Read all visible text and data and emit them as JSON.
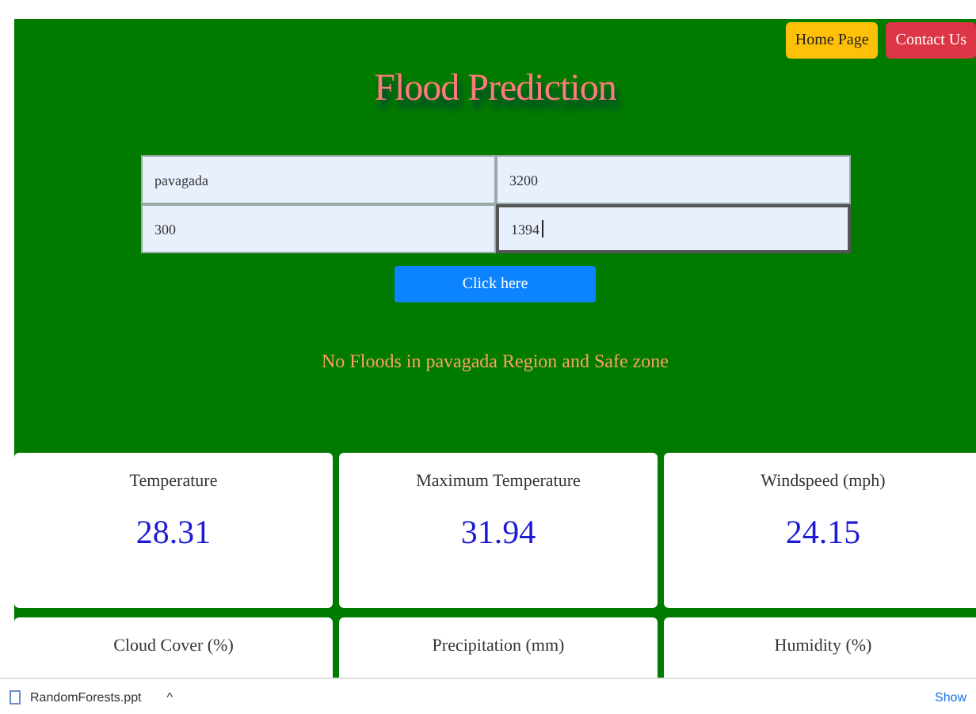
{
  "nav": {
    "buttons": [
      {
        "label": "Home Page",
        "kind": "warning"
      },
      {
        "label": "Contact Us",
        "kind": "danger"
      }
    ]
  },
  "title": "Flood Prediction",
  "form": {
    "fields": [
      {
        "value": "pavagada",
        "focused": false
      },
      {
        "value": "3200",
        "focused": false
      },
      {
        "value": "300",
        "focused": false
      },
      {
        "value": "1394",
        "focused": true
      }
    ],
    "submit": "Click here"
  },
  "result": "No Floods in pavagada Region and Safe zone",
  "cards": [
    {
      "label": "Temperature",
      "value": "28.31"
    },
    {
      "label": "Maximum Temperature",
      "value": "31.94"
    },
    {
      "label": "Windspeed (mph)",
      "value": "24.15"
    },
    {
      "label": "Cloud Cover (%)"
    },
    {
      "label": "Precipitation (mm)"
    },
    {
      "label": "Humidity (%)"
    }
  ],
  "download_bar": {
    "file": "RandomForests.ppt",
    "caret": "^",
    "show": "Show"
  }
}
